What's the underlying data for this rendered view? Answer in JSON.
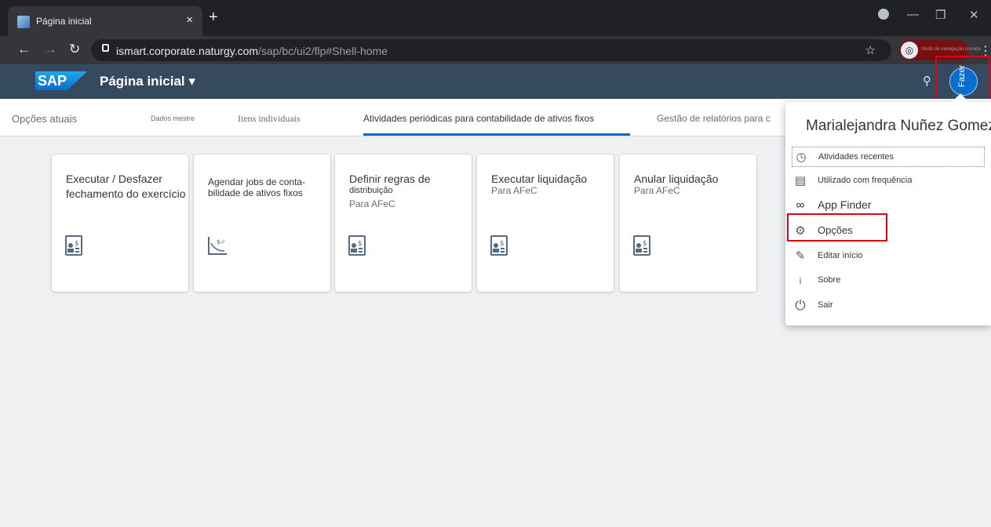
{
  "browser": {
    "tab_title": "Página inicial",
    "tab_close": "×",
    "new_tab": "+",
    "url_host": "ismart.corporate.naturgy.com",
    "url_path": "/sap/bc/ui2/flp#Shell-home",
    "profile_label": "Modo de navegação privada",
    "window_controls": [
      "minimize-icon",
      "restore-icon",
      "close-icon"
    ]
  },
  "shell": {
    "logo": "SAP",
    "title": "Página inicial ▾",
    "avatar_text": "Fazer",
    "brand_color": "#354a5f",
    "accent_color": "#0a6ed1"
  },
  "anchors": {
    "items": [
      {
        "label": "Opções atuais"
      },
      {
        "label": "Dados mestre"
      },
      {
        "label": "Itens individuais"
      },
      {
        "label": "Atividades periódicas para contabilidade de ativos fixos"
      },
      {
        "label": "Gestão de relatórios para c"
      }
    ],
    "active_index": 3
  },
  "tiles": [
    {
      "title": "Executar / Desfazer fechamento do exercício",
      "line1": "Executar / Desfazer",
      "line2": "fechamento do exercício",
      "icon": "document-money-icon"
    },
    {
      "title": "Agendar jobs de contabilidade de ativos fixos",
      "line1": "Agendar jobs de conta-",
      "line2": "bilidade de ativos fixos",
      "icon": "depreciation-chart-icon"
    },
    {
      "title": "Definir regras de distribuição",
      "line1": "Definir regras de",
      "line2": "distribuição",
      "subtitle": "Para AFeC",
      "icon": "document-money-icon"
    },
    {
      "title": "Executar liquidação",
      "line1": "Executar liquidação",
      "subtitle": "Para AFeC",
      "icon": "document-money-icon"
    },
    {
      "title": "Anular liquidação",
      "line1": "Anular liquidação",
      "subtitle": "Para AFeC",
      "icon": "document-money-icon"
    }
  ],
  "me_area": {
    "user_name": "Marialejandra Nuñez Gomez",
    "items": [
      {
        "label": "Atividades recentes",
        "icon": "recent-activities-icon"
      },
      {
        "label": "Utilizado com frequência",
        "icon": "frequently-used-icon"
      },
      {
        "label": "App Finder",
        "icon": "binoculars-icon"
      },
      {
        "label": "Opções",
        "icon": "gear-icon"
      },
      {
        "label": "Editar início",
        "icon": "pencil-icon"
      },
      {
        "label": "Sobre",
        "icon": "info-icon"
      },
      {
        "label": "Sair",
        "icon": "power-icon"
      }
    ]
  }
}
